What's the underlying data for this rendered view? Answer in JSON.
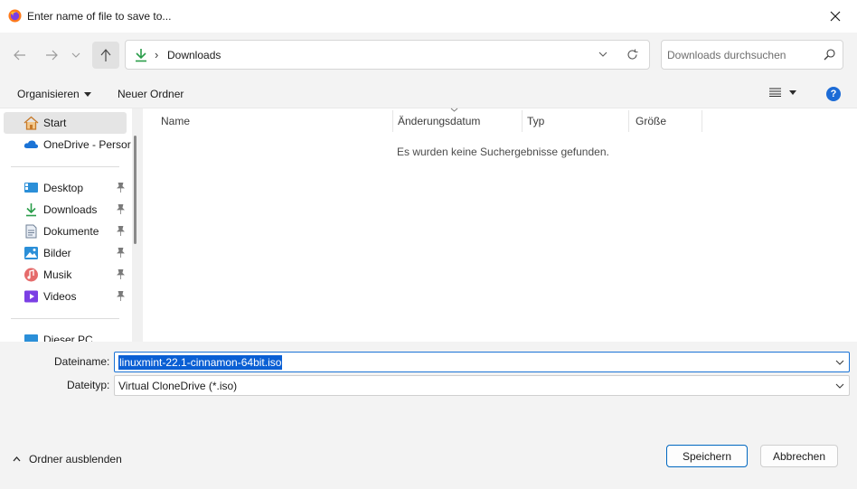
{
  "window": {
    "title": "Enter name of file to save to...",
    "app_icon": "firefox-icon"
  },
  "nav": {
    "back_icon": "arrow-left-icon",
    "forward_icon": "arrow-right-icon",
    "recent_icon": "chevron-down-icon",
    "up_icon": "arrow-up-icon",
    "breadcrumb_separator": "›",
    "path": "Downloads",
    "search_placeholder": "Downloads durchsuchen"
  },
  "commands": {
    "organize": "Organisieren",
    "new_folder": "Neuer Ordner",
    "help": "?"
  },
  "sidebar": {
    "items": [
      {
        "label": "Start",
        "icon": "home-icon"
      },
      {
        "label": "OneDrive - Persor",
        "icon": "cloud-icon"
      },
      {
        "label": "Desktop",
        "icon": "desktop-icon"
      },
      {
        "label": "Downloads",
        "icon": "download-icon"
      },
      {
        "label": "Dokumente",
        "icon": "document-icon"
      },
      {
        "label": "Bilder",
        "icon": "pictures-icon"
      },
      {
        "label": "Musik",
        "icon": "music-icon"
      },
      {
        "label": "Videos",
        "icon": "video-icon"
      },
      {
        "label": "Dieser PC",
        "icon": "pc-icon"
      }
    ]
  },
  "columns": [
    "Name",
    "Änderungsdatum",
    "Typ",
    "Größe"
  ],
  "empty_message": "Es wurden keine Suchergebnisse gefunden.",
  "form": {
    "filename_label": "Dateiname:",
    "filename_value": "linuxmint-22.1-cinnamon-64bit.iso",
    "filetype_label": "Dateityp:",
    "filetype_value": "Virtual CloneDrive (*.iso)"
  },
  "footer": {
    "hide_folders": "Ordner ausblenden",
    "save": "Speichern",
    "cancel": "Abbrechen"
  },
  "colors": {
    "accent": "#0067c0",
    "selection": "#0a5fd4",
    "download_green": "#2a9d4a"
  }
}
